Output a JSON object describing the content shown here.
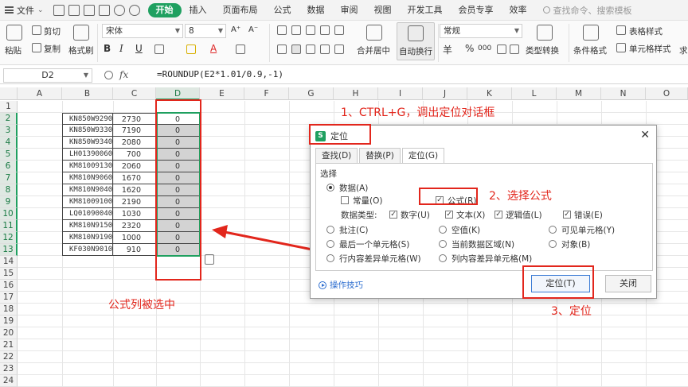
{
  "menubar": {
    "file_label": "文件",
    "file_arrow": "⌄",
    "tabs": [
      "开始",
      "插入",
      "页面布局",
      "公式",
      "数据",
      "审阅",
      "视图",
      "开发工具",
      "会员专享",
      "效率"
    ],
    "active_tab": "开始",
    "search_placeholder": "查找命令、搜索模板"
  },
  "ribbon": {
    "paste": "粘贴",
    "cut": "剪切",
    "copy": "复制",
    "format_painter": "格式刷",
    "font_name": "宋体",
    "font_size": "8",
    "number_format": "常规",
    "merge_center": "合并居中",
    "wrap_text": "自动换行",
    "type_convert": "类型转换",
    "conditional_format": "条件格式",
    "table_style": "表格样式",
    "cell_style": "单元格样式",
    "percent": "%",
    "currency": "羊",
    "bold": "B",
    "italic": "I",
    "underline": "U",
    "font_color_a": "A",
    "font_grow": "A⁺",
    "font_shrink": "A⁻",
    "thousand": "000",
    "more": "求"
  },
  "formula_bar": {
    "cell_ref": "D2",
    "fx": "fx",
    "formula": "=ROUNDUP(E2*1.01/0.9,-1)"
  },
  "sheet": {
    "columns": [
      "A",
      "B",
      "C",
      "D",
      "E",
      "F",
      "G",
      "H",
      "I",
      "J",
      "K",
      "L",
      "M",
      "N",
      "O"
    ],
    "rows": [
      "1",
      "2",
      "3",
      "4",
      "5",
      "6",
      "7",
      "8",
      "9",
      "10",
      "11",
      "12",
      "13",
      "14",
      "15",
      "16",
      "17",
      "18",
      "19",
      "20",
      "21",
      "22",
      "23",
      "24"
    ],
    "data": [
      {
        "b": "KN850W9290",
        "c": "2730",
        "d": "0"
      },
      {
        "b": "KN850W9330",
        "c": "7190",
        "d": "0"
      },
      {
        "b": "KN850W9340",
        "c": "2080",
        "d": "0"
      },
      {
        "b": "LH01390060",
        "c": "700",
        "d": "0"
      },
      {
        "b": "KM81009130",
        "c": "2060",
        "d": "0"
      },
      {
        "b": "KM810N9060",
        "c": "1670",
        "d": "0"
      },
      {
        "b": "KM810N9040",
        "c": "1620",
        "d": "0"
      },
      {
        "b": "KM81009100",
        "c": "2190",
        "d": "0"
      },
      {
        "b": "LQ01090040",
        "c": "1030",
        "d": "0"
      },
      {
        "b": "KM810N9150",
        "c": "2320",
        "d": "0"
      },
      {
        "b": "KM810N9190",
        "c": "1000",
        "d": "0"
      },
      {
        "b": "KF030N9010",
        "c": "910",
        "d": "0"
      }
    ]
  },
  "dialog": {
    "title": "定位",
    "logo": "S",
    "close": "✕",
    "tabs": [
      "查找(D)",
      "替换(P)",
      "定位(G)"
    ],
    "group_label": "选择",
    "data_option": "数据(A)",
    "constant": "常量(O)",
    "formula": "公式(R)",
    "data_type_label": "数据类型:",
    "number": "数字(U)",
    "text": "文本(X)",
    "logical": "逻辑值(L)",
    "error": "错误(E)",
    "comment": "批注(C)",
    "blank": "空值(K)",
    "visible_cells": "可见单元格(Y)",
    "last_cell": "最后一个单元格(S)",
    "current_region": "当前数据区域(N)",
    "objects": "对象(B)",
    "row_diff": "行内容差异单元格(W)",
    "col_diff": "列内容差异单元格(M)",
    "tips": "操作技巧",
    "goto_btn": "定位(T)",
    "close_btn": "关闭",
    "check_mark": "✓"
  },
  "annotations": {
    "step1": "1、CTRL+G，调出定位对话框",
    "step2": "2、选择公式",
    "step3": "3、定位",
    "selected": "公式列被选中"
  },
  "colors": {
    "accent": "#1fa060",
    "annotation": "#e2261c"
  }
}
